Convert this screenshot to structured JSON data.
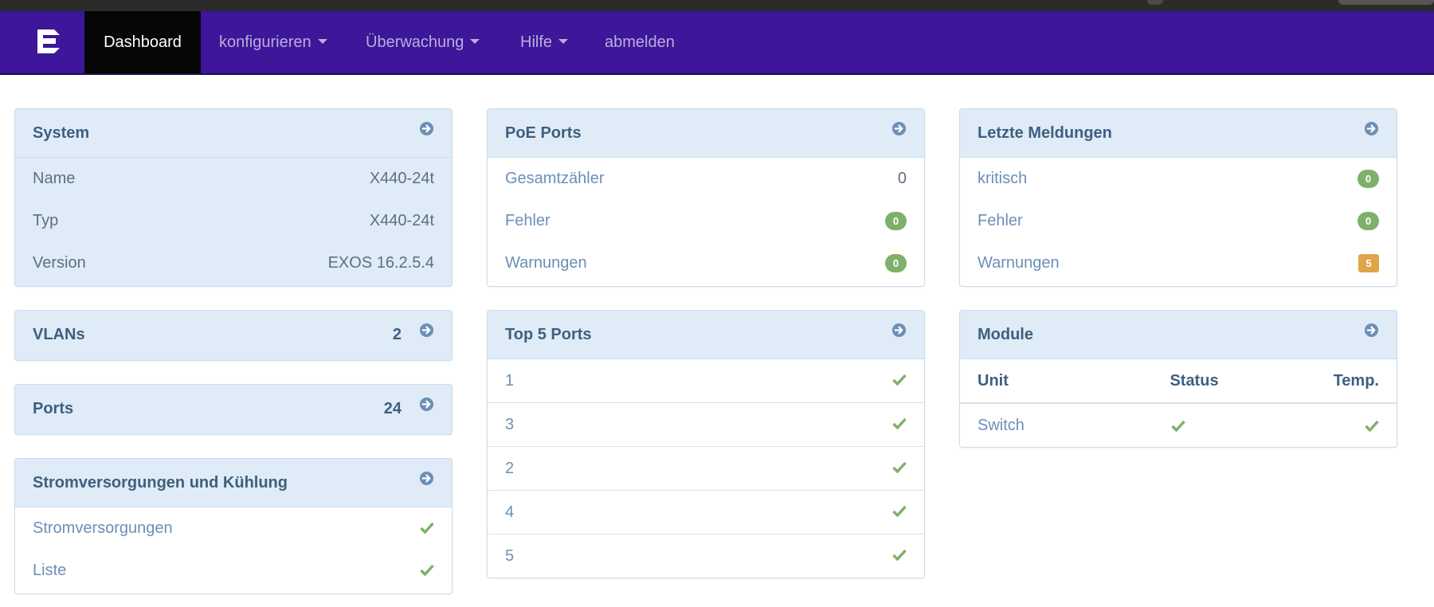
{
  "colors": {
    "navbar": "#3d1699",
    "active_tab": "#060606",
    "panel_header": "#dfebf6",
    "ok_green": "#7fb069",
    "warn_orange": "#e0a54a",
    "link_blue": "#6b8fb8"
  },
  "nav": {
    "logo_icon": "extreme-logo-icon",
    "items": [
      {
        "label": "Dashboard"
      },
      {
        "label": "konfigurieren"
      },
      {
        "label": "Überwachung"
      },
      {
        "label": "Hilfe"
      },
      {
        "label": "abmelden"
      }
    ]
  },
  "system": {
    "title": "System",
    "rows": [
      {
        "label": "Name",
        "value": "X440-24t"
      },
      {
        "label": "Typ",
        "value": "X440-24t"
      },
      {
        "label": "Version",
        "value": "EXOS 16.2.5.4"
      }
    ]
  },
  "vlans": {
    "title": "VLANs",
    "count": "2"
  },
  "ports": {
    "title": "Ports",
    "count": "24"
  },
  "power": {
    "title": "Stromversorgungen und Kühlung",
    "rows": [
      {
        "label": "Stromversorgungen",
        "status": "ok"
      },
      {
        "label": "Liste",
        "status": "ok"
      }
    ]
  },
  "poe": {
    "title": "PoE Ports",
    "rows": [
      {
        "label": "Gesamtzähler",
        "value": "0"
      },
      {
        "label": "Fehler",
        "badge": "0"
      },
      {
        "label": "Warnungen",
        "badge": "0"
      }
    ]
  },
  "top_ports": {
    "title": "Top 5 Ports",
    "rows": [
      {
        "label": "1",
        "status": "ok"
      },
      {
        "label": "3",
        "status": "ok"
      },
      {
        "label": "2",
        "status": "ok"
      },
      {
        "label": "4",
        "status": "ok"
      },
      {
        "label": "5",
        "status": "ok"
      }
    ]
  },
  "messages": {
    "title": "Letzte Meldungen",
    "rows": [
      {
        "label": "kritisch",
        "badge": "0"
      },
      {
        "label": "Fehler",
        "badge": "0"
      },
      {
        "label": "Warnungen",
        "badge": "5"
      }
    ]
  },
  "modules": {
    "title": "Module",
    "headers": [
      "Unit",
      "Status",
      "Temp."
    ],
    "rows": [
      {
        "unit": "Switch",
        "status": "ok",
        "temp": "ok"
      }
    ]
  }
}
